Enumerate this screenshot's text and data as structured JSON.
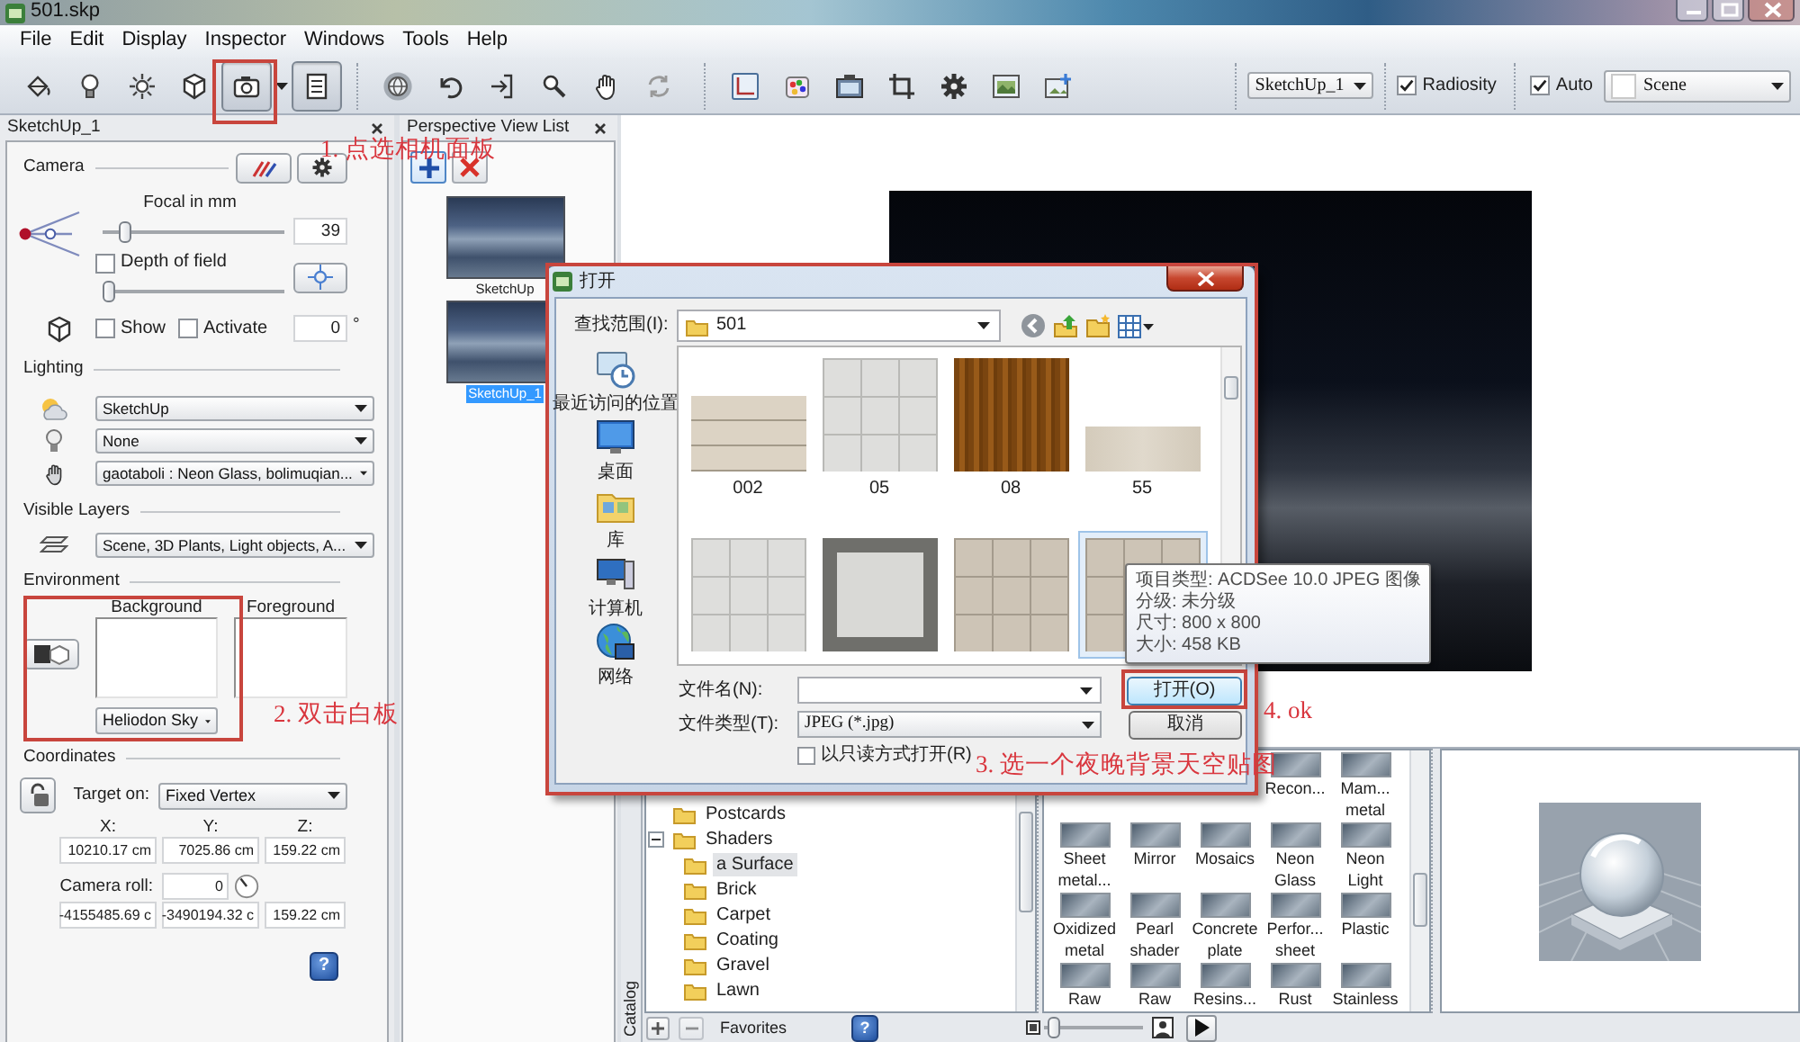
{
  "window": {
    "title": "501.skp"
  },
  "menu": [
    "File",
    "Edit",
    "Display",
    "Inspector",
    "Windows",
    "Tools",
    "Help"
  ],
  "toolbar": {
    "groups": [
      [
        {
          "kind": "button",
          "selected": false
        },
        {
          "kind": "button",
          "selected": false
        },
        {
          "kind": "button",
          "selected": false
        },
        {
          "kind": "button",
          "selected": false
        },
        {
          "kind": "button",
          "selected": true
        },
        {
          "kind": "arrow"
        },
        {
          "kind": "button",
          "selected": true
        }
      ],
      [
        {
          "kind": "button",
          "selected": false
        },
        {
          "kind": "button",
          "selected": false
        },
        {
          "kind": "button",
          "selected": false
        },
        {
          "kind": "button",
          "selected": false
        },
        {
          "kind": "button",
          "selected": false
        },
        {
          "kind": "button",
          "selected": false
        }
      ],
      [
        {
          "kind": "button",
          "selected": false
        },
        {
          "kind": "button",
          "selected": false
        },
        {
          "kind": "button",
          "selected": false
        },
        {
          "kind": "button",
          "selected": false
        },
        {
          "kind": "button",
          "selected": false
        },
        {
          "kind": "button",
          "selected": false
        },
        {
          "kind": "button",
          "selected": false
        }
      ]
    ],
    "view": "SketchUp_1",
    "radiosity": {
      "label": "Radiosity",
      "checked": true
    },
    "auto": {
      "label": "Auto",
      "checked": true
    },
    "scene": "Scene"
  },
  "inspector": {
    "title": "SketchUp_1",
    "camera": {
      "heading": "Camera",
      "focal": {
        "label": "Focal in mm",
        "level": 0.1,
        "value": "39"
      },
      "depth_of_field": {
        "label": "Depth of field",
        "checked": false,
        "level": 0
      },
      "show": {
        "label": "Show",
        "checked": false
      },
      "activate": {
        "label": "Activate",
        "checked": false
      },
      "angle": "0",
      "angle_unit": "°"
    },
    "lighting": {
      "heading": "Lighting",
      "selects": [
        "SketchUp",
        "None",
        "gaotaboli : Neon Glass, bolimuqian..."
      ]
    },
    "visible_layers": {
      "heading": "Visible Layers",
      "select": "Scene, 3D Plants, Light objects, A..."
    },
    "environment": {
      "heading": "Environment",
      "background": "Background",
      "foreground": "Foreground",
      "background_type": "Heliodon Sky"
    },
    "coordinates": {
      "heading": "Coordinates",
      "target_label": "Target on:",
      "target": "Fixed Vertex",
      "axes": [
        "X:",
        "Y:",
        "Z:"
      ],
      "position": [
        "10210.17 cm",
        "7025.86 cm",
        "159.22 cm"
      ],
      "roll_label": "Camera roll:",
      "roll": "0",
      "target_position": [
        "-4155485.69 c",
        "-3490194.32 c",
        "159.22 cm"
      ],
      "help": "?"
    }
  },
  "view_list": {
    "title": "Perspective View List",
    "views": [
      {
        "label": "SketchUp",
        "selected": false
      },
      {
        "label": "SketchUp_1",
        "selected": true
      }
    ]
  },
  "catalog": {
    "label": "Catalog",
    "tree": [
      {
        "label": "Postcards",
        "selected": false
      },
      {
        "label": "Shaders",
        "selected": false,
        "expanded": true,
        "children": [
          {
            "label": "a Surface",
            "selected": true
          },
          {
            "label": "Brick",
            "selected": false
          },
          {
            "label": "Carpet",
            "selected": false
          },
          {
            "label": "Coating",
            "selected": false
          },
          {
            "label": "Gravel",
            "selected": false
          },
          {
            "label": "Lawn",
            "selected": false
          }
        ]
      }
    ],
    "materials": [
      [
        {
          "label": "Recon..."
        },
        {
          "label": "Mam... metal"
        }
      ],
      [
        {
          "label": "Sheet metal..."
        },
        {
          "label": "Mirror"
        },
        {
          "label": "Mosaics"
        },
        {
          "label": "Neon Glass"
        },
        {
          "label": "Neon Light"
        }
      ],
      [
        {
          "label": "Oxidized metal"
        },
        {
          "label": "Pearl shader"
        },
        {
          "label": "Concrete plate"
        },
        {
          "label": "Perfor... sheet"
        },
        {
          "label": "Plastic"
        }
      ],
      [
        {
          "label": "Raw"
        },
        {
          "label": "Raw"
        },
        {
          "label": "Resins..."
        },
        {
          "label": "Rust"
        },
        {
          "label": "Stainless"
        }
      ]
    ],
    "favorites_buttons": [
      {
        "kind": "add",
        "disabled": false
      },
      {
        "kind": "remove",
        "disabled": true
      }
    ],
    "favorites": "Favorites",
    "help": "?",
    "size_slider": {
      "level": 0.05
    }
  },
  "dialog": {
    "title": "打开",
    "look_in_label": "查找范围(I):",
    "look_in": "501",
    "places": [
      "最近访问的位置",
      "桌面",
      "库",
      "计算机",
      "网络"
    ],
    "files": [
      {
        "kind": "planks",
        "name": "002",
        "selected": false
      },
      {
        "kind": "tiles",
        "name": "05",
        "selected": false
      },
      {
        "kind": "grain",
        "name": "08",
        "selected": false
      },
      {
        "kind": "strip",
        "name": "55",
        "selected": false
      },
      {
        "kind": "tiles",
        "selected": false
      },
      {
        "kind": "frame",
        "selected": false
      },
      {
        "kind": "beige",
        "selected": false
      },
      {
        "kind": "beige",
        "selected": true
      }
    ],
    "tooltip": [
      "项目类型: ACDSee 10.0 JPEG 图像",
      "分级: 未分级",
      "尺寸: 800 x 800",
      "大小: 458 KB"
    ],
    "file_name_label": "文件名(N):",
    "file_type_label": "文件类型(T):",
    "file_type": "JPEG (*.jpg)",
    "read_only": {
      "label": "以只读方式打开(R)",
      "checked": false
    },
    "buttons": [
      {
        "label": "打开(O)",
        "default": true
      },
      {
        "label": "取消",
        "default": false
      }
    ]
  },
  "annotations": [
    "1. 点选相机面板",
    "2. 双击白板",
    "3. 选一个夜晚背景天空贴图",
    "4. ok"
  ]
}
